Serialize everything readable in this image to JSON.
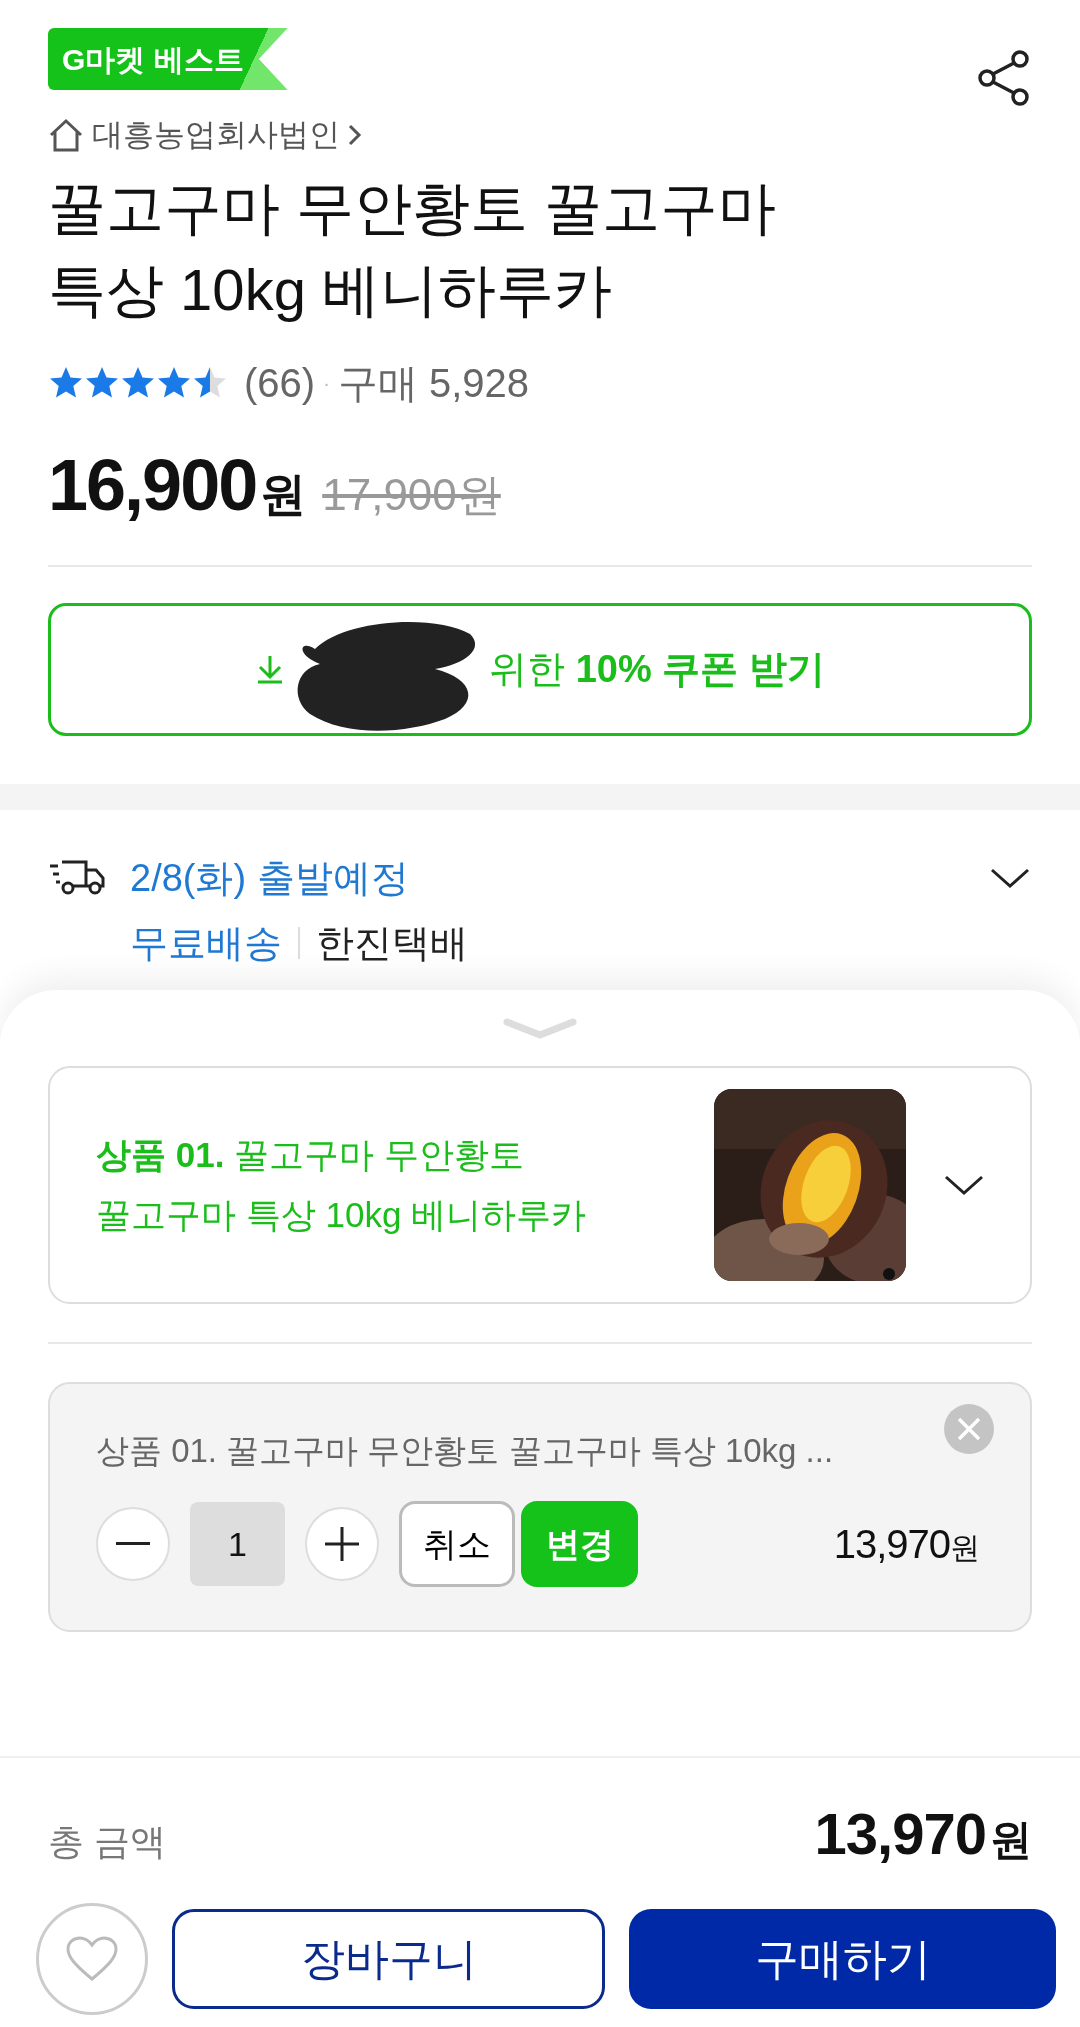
{
  "badge": "G마켓 베스트",
  "seller": "대흥농업회사법인",
  "title": "꿀고구마 무안황토 꿀고구마 특상 10kg 베니하루카",
  "rating": {
    "stars": 4.5,
    "review_count": "(66)",
    "separator": "·",
    "purchases": "구매 5,928"
  },
  "price": {
    "amount": "16,900",
    "unit": "원",
    "original": "17,900원"
  },
  "coupon": {
    "text": "위한 **10% 쿠폰 받기**"
  },
  "delivery": {
    "date": "2/8(화) 출발예정",
    "fee": "무료배송",
    "carrier": "한진택배"
  },
  "option": {
    "text": "**상품 01.** 꿀고구마 무안황토 꿀고구마 특상 10kg 베니하루카"
  },
  "selected_item": {
    "name": "상품 01. 꿀고구마 무안황토 꿀고구마 특상 10kg ...",
    "quantity": "1",
    "cancel": "취소",
    "change": "변경",
    "price": "13,970",
    "unit": "원"
  },
  "total": {
    "label": "총 금액",
    "amount": "13,970",
    "unit": "원"
  },
  "actions": {
    "cart": "장바구니",
    "buy": "구매하기"
  }
}
